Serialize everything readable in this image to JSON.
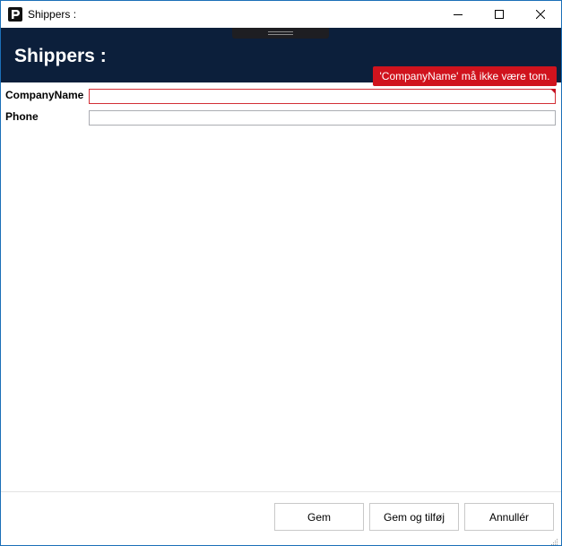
{
  "window": {
    "title": "Shippers :",
    "app_icon": "p-app-icon",
    "controls": [
      "minimize-icon",
      "maximize-icon",
      "close-icon"
    ]
  },
  "header": {
    "title": "Shippers :",
    "background": "#0c1f3b"
  },
  "form": {
    "fields": [
      {
        "label": "CompanyName",
        "value": "",
        "state": "error"
      },
      {
        "label": "Phone",
        "value": "",
        "state": "normal"
      }
    ],
    "validation_message": "'CompanyName' må ikke være tom.",
    "error_color": "#d0131d"
  },
  "footer": {
    "buttons": [
      "Gem",
      "Gem og tilføj",
      "Annullér"
    ]
  }
}
